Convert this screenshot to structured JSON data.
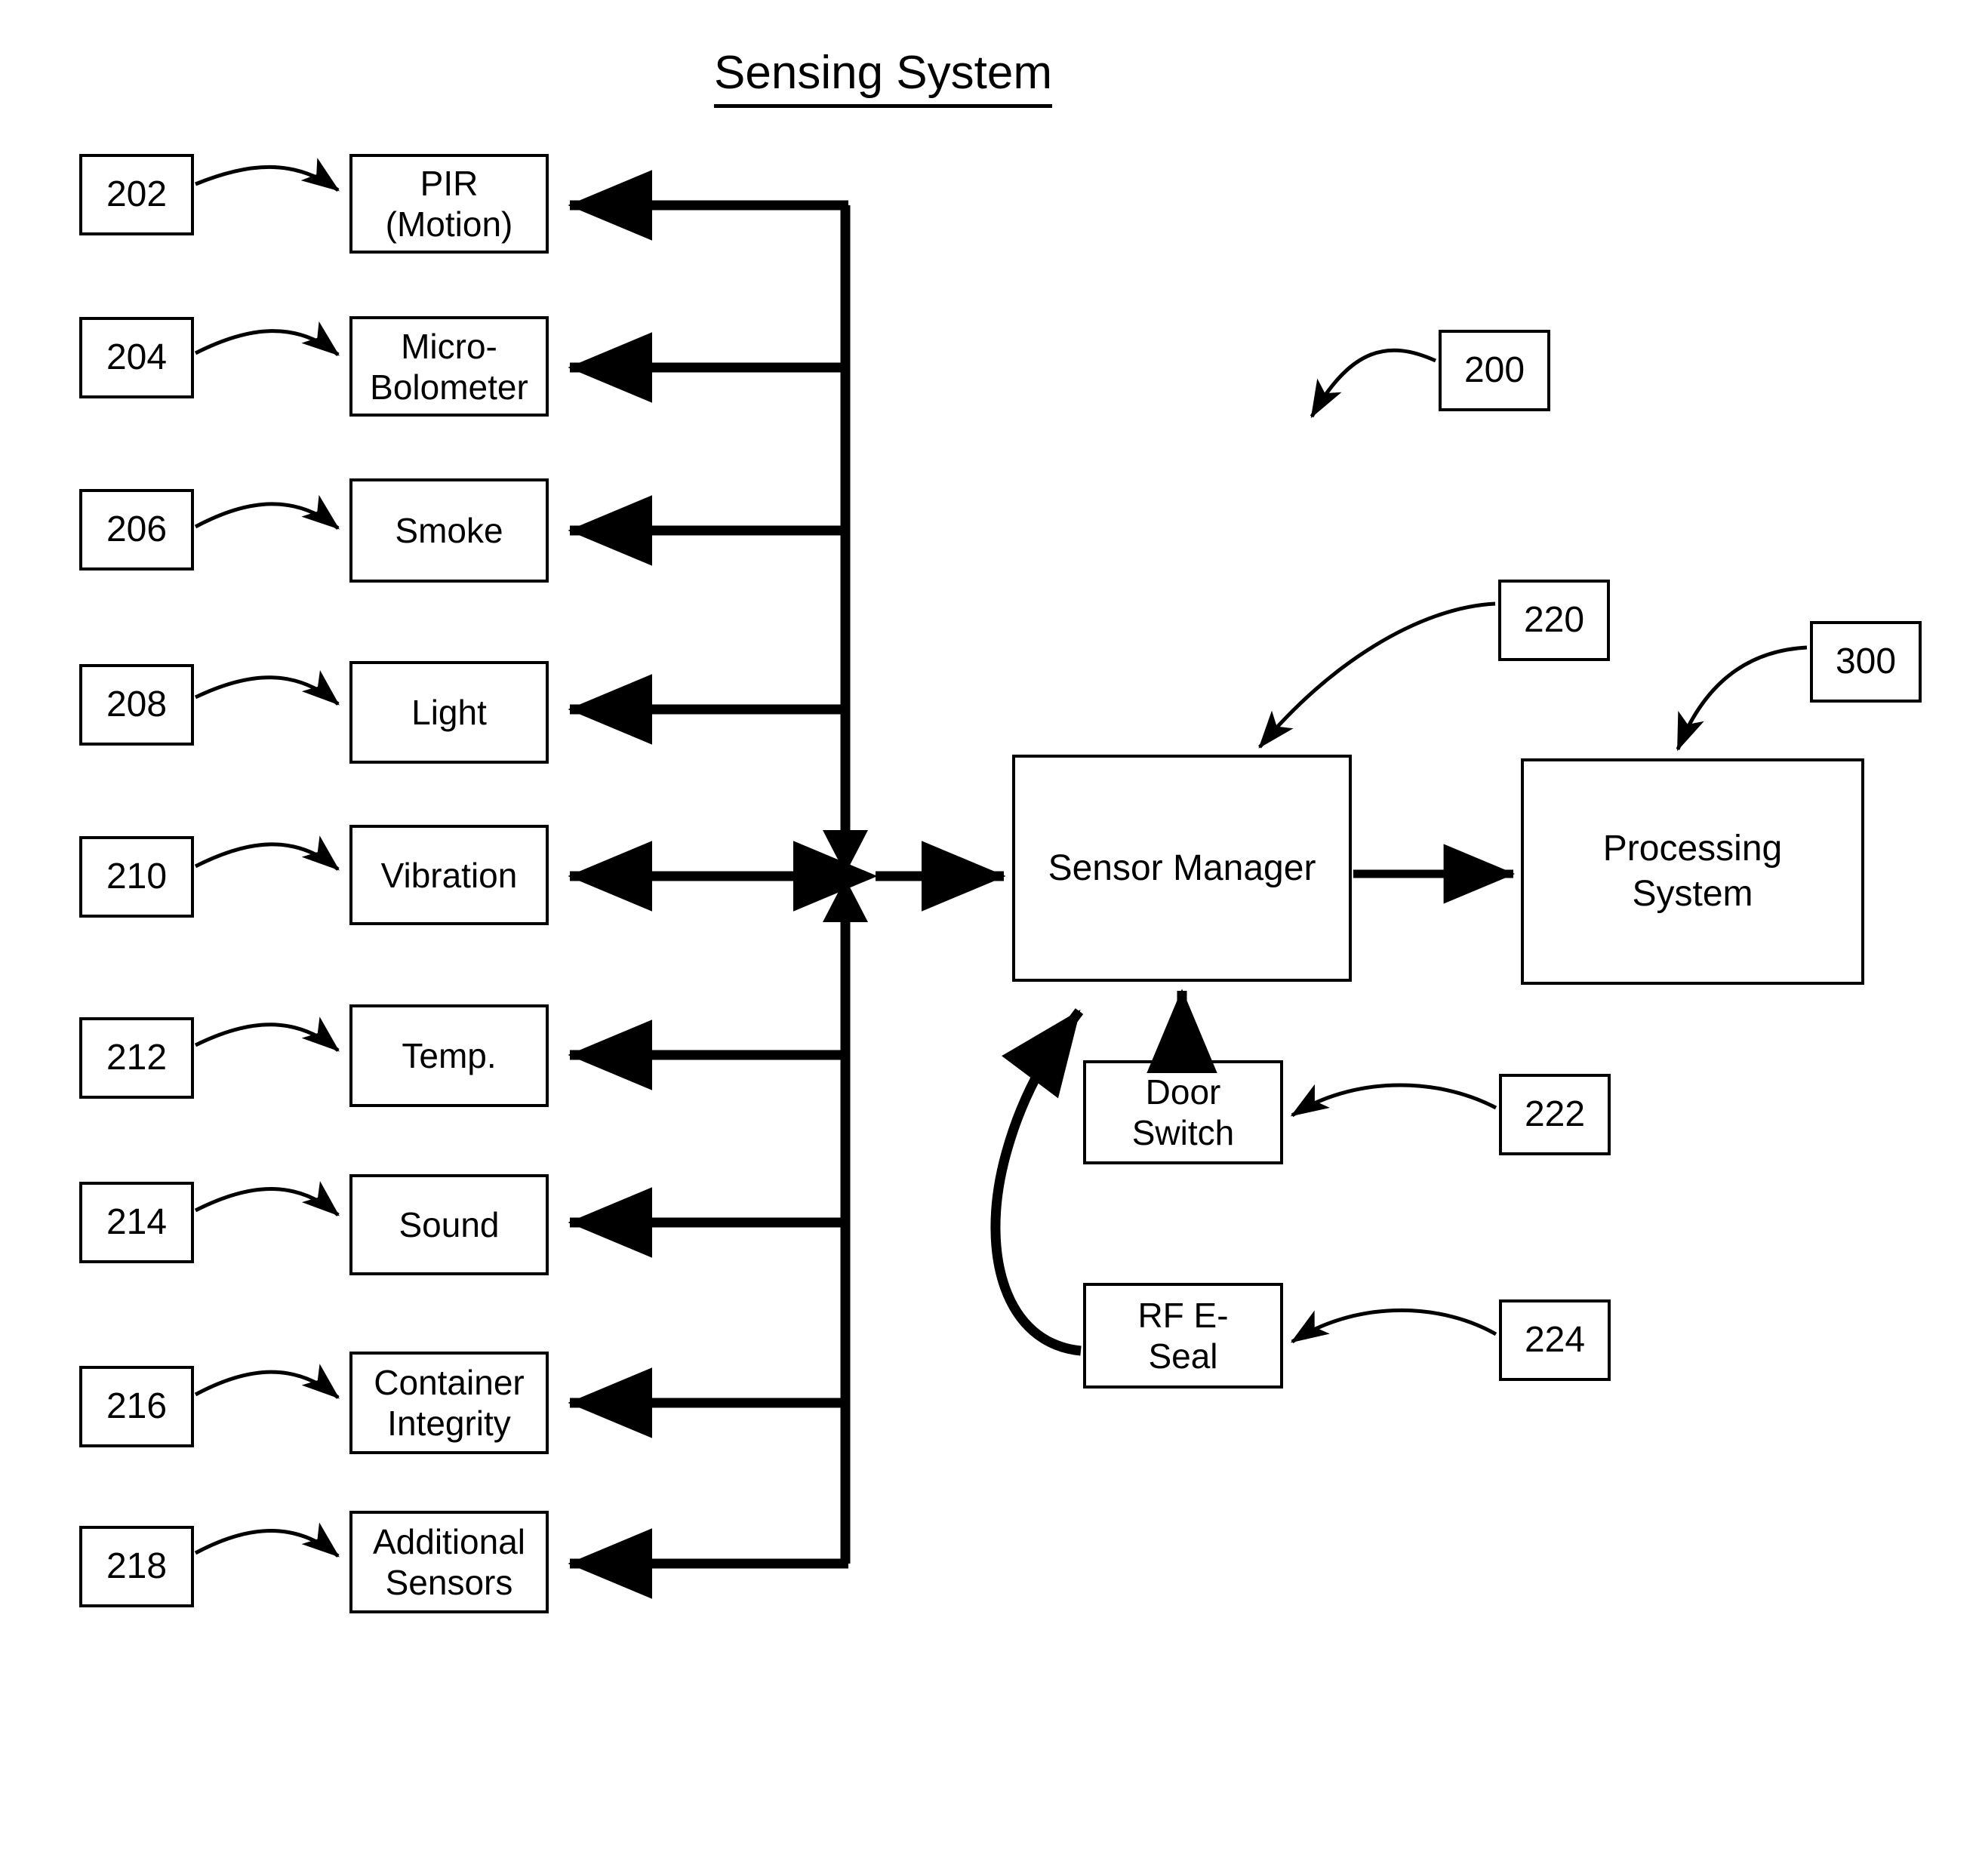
{
  "diagram": {
    "title": "Sensing System",
    "title_underlined": true,
    "figure_label": "200",
    "ink_color": "#000000",
    "background_color": "#ffffff"
  },
  "sensors": [
    {
      "ref": "202",
      "label": "PIR\n(Motion)",
      "label_line1": "PIR",
      "label_line2": "(Motion)"
    },
    {
      "ref": "204",
      "label": "Micro-\nBolometer",
      "label_line1": "Micro-",
      "label_line2": "Bolometer"
    },
    {
      "ref": "206",
      "label": "Smoke",
      "label_line1": "Smoke",
      "label_line2": ""
    },
    {
      "ref": "208",
      "label": "Light",
      "label_line1": "Light",
      "label_line2": ""
    },
    {
      "ref": "210",
      "label": "Vibration",
      "label_line1": "Vibration",
      "label_line2": ""
    },
    {
      "ref": "212",
      "label": "Temp.",
      "label_line1": "Temp.",
      "label_line2": ""
    },
    {
      "ref": "214",
      "label": "Sound",
      "label_line1": "Sound",
      "label_line2": ""
    },
    {
      "ref": "216",
      "label": "Container\nIntegrity",
      "label_line1": "Container",
      "label_line2": "Integrity"
    },
    {
      "ref": "218",
      "label": "Additional\nSensors",
      "label_line1": "Additional",
      "label_line2": "Sensors"
    }
  ],
  "blocks": {
    "sensor_manager": {
      "label": "Sensor Manager",
      "ref": "220"
    },
    "processing_system": {
      "label": "Processing\nSystem",
      "label_line1": "Processing",
      "label_line2": "System",
      "ref": "300"
    },
    "door_switch": {
      "label": "Door\nSwitch",
      "label_line1": "Door",
      "label_line2": "Switch",
      "ref": "222"
    },
    "rf_e_seal": {
      "label": "RF E-\nSeal",
      "label_line1": "RF E-",
      "label_line2": "Seal",
      "ref": "224"
    }
  },
  "reference_numerals": [
    "200",
    "202",
    "204",
    "206",
    "208",
    "210",
    "212",
    "214",
    "216",
    "218",
    "220",
    "222",
    "224",
    "300"
  ]
}
